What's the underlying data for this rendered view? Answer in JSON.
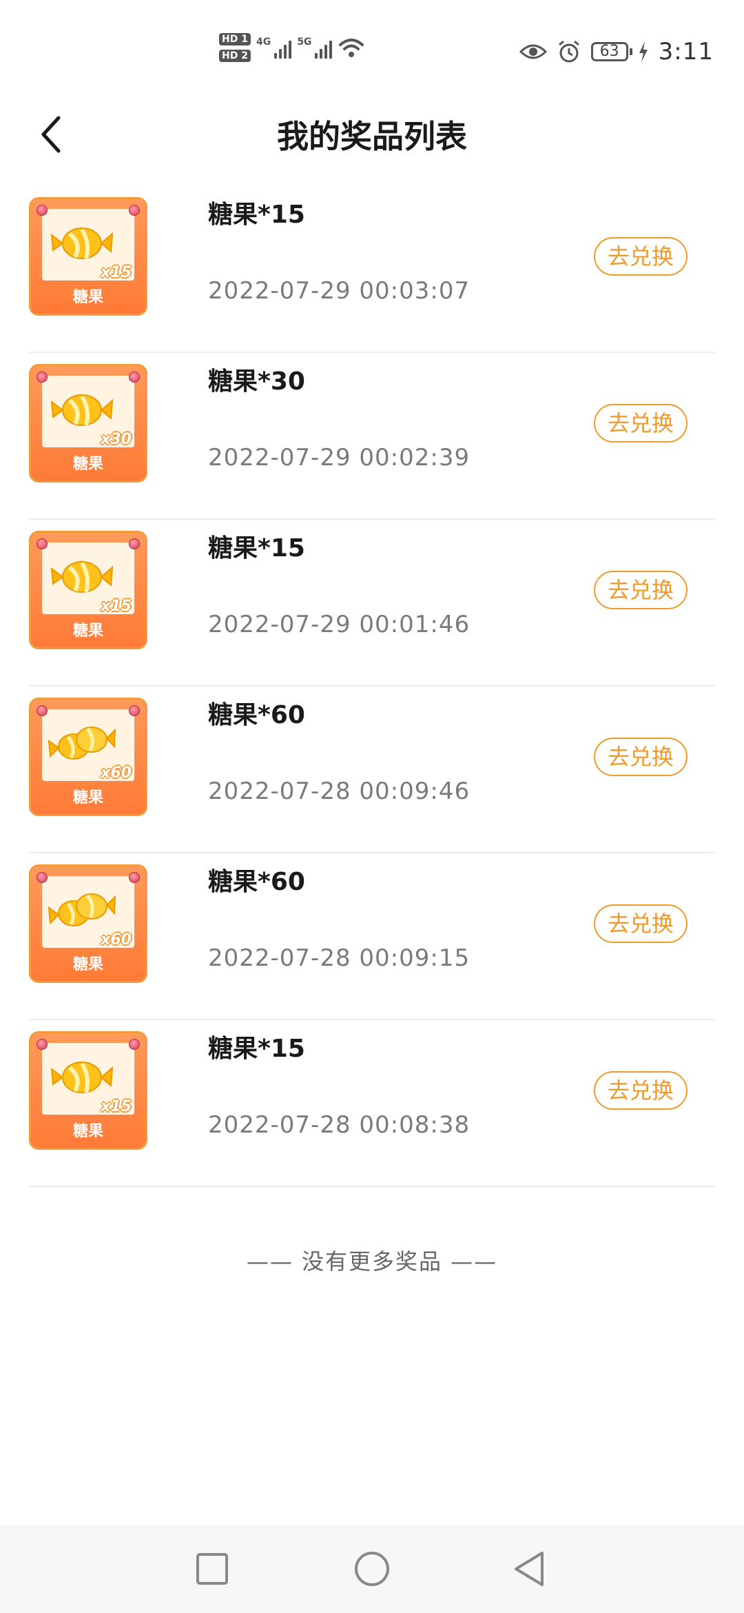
{
  "status_bar": {
    "hd1": "HD 1",
    "hd2": "HD 2",
    "net1": "4G",
    "net2": "5G",
    "battery": "63",
    "time": "3:11",
    "icons": [
      "signal-icon",
      "wifi-icon",
      "eye-icon",
      "alarm-icon",
      "battery-icon",
      "charging-icon"
    ]
  },
  "header": {
    "title": "我的奖品列表",
    "back_icon": "chevron-left-icon"
  },
  "prizes": [
    {
      "name": "糖果*15",
      "date": "2022-07-29 00:03:07",
      "button": "去兑换",
      "thumb_mult": "x15",
      "thumb_label": "糖果",
      "candy": "single"
    },
    {
      "name": "糖果*30",
      "date": "2022-07-29 00:02:39",
      "button": "去兑换",
      "thumb_mult": "x30",
      "thumb_label": "糖果",
      "candy": "single"
    },
    {
      "name": "糖果*15",
      "date": "2022-07-29 00:01:46",
      "button": "去兑换",
      "thumb_mult": "x15",
      "thumb_label": "糖果",
      "candy": "single"
    },
    {
      "name": "糖果*60",
      "date": "2022-07-28 00:09:46",
      "button": "去兑换",
      "thumb_mult": "x60",
      "thumb_label": "糖果",
      "candy": "double"
    },
    {
      "name": "糖果*60",
      "date": "2022-07-28 00:09:15",
      "button": "去兑换",
      "thumb_mult": "x60",
      "thumb_label": "糖果",
      "candy": "double"
    },
    {
      "name": "糖果*15",
      "date": "2022-07-28 00:08:38",
      "button": "去兑换",
      "thumb_mult": "x15",
      "thumb_label": "糖果",
      "candy": "single"
    }
  ],
  "footer_note": "—— 没有更多奖品 ——",
  "nav": {
    "icons": [
      "square-recent-icon",
      "circle-home-icon",
      "triangle-back-icon"
    ]
  },
  "colors": {
    "accent": "#f09a2a",
    "thumb_bg": "#ff8a45",
    "title": "#1a1a1a",
    "date": "#7a7a7a"
  }
}
